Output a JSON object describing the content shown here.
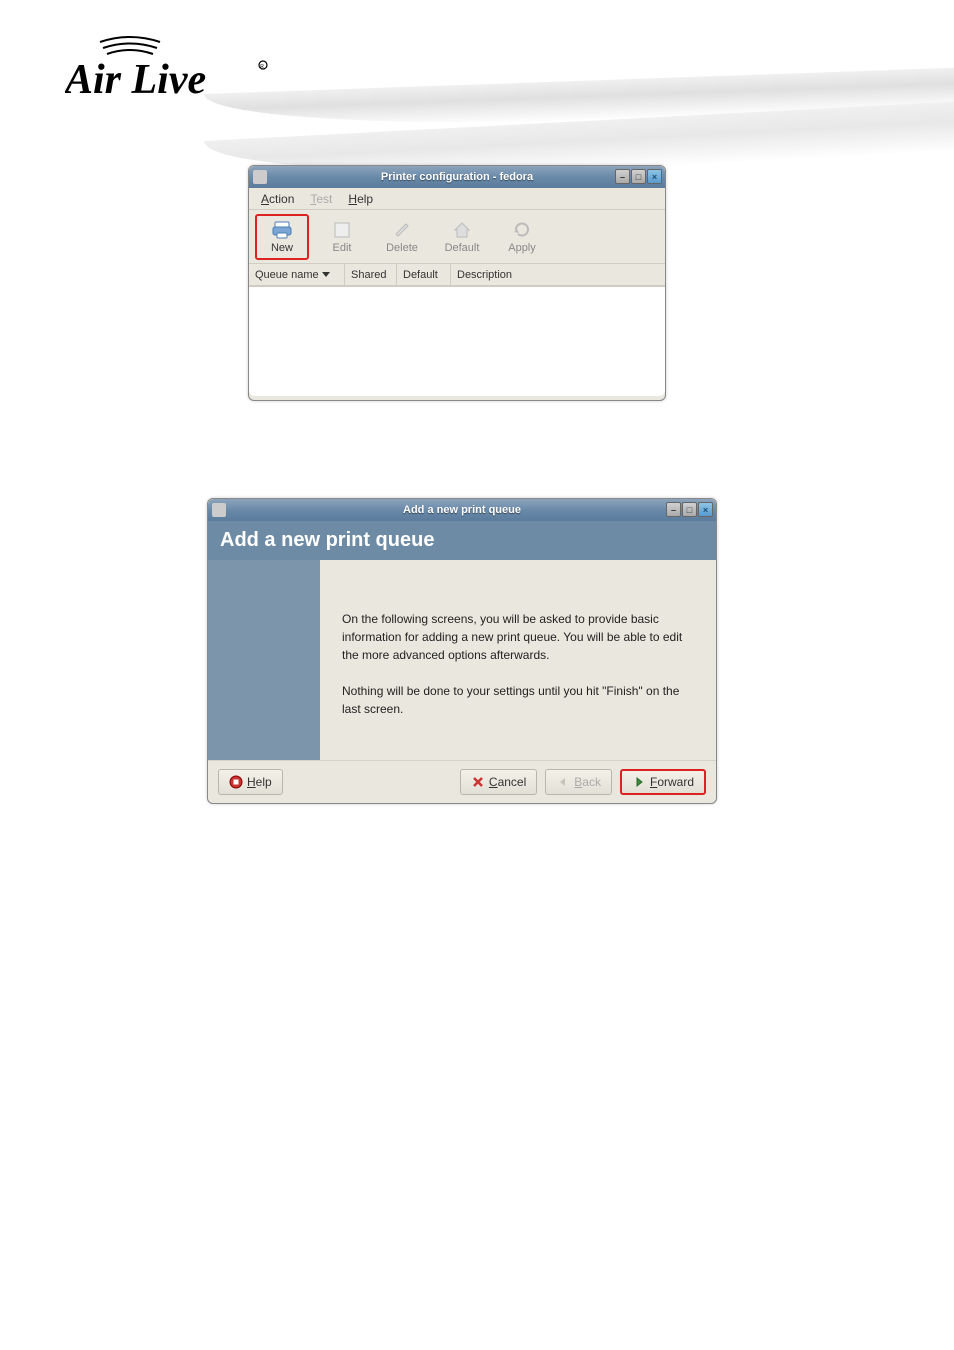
{
  "logo_text": "Air Live",
  "window1": {
    "title": "Printer configuration - fedora",
    "menu": {
      "action": "Action",
      "test": "Test",
      "help": "Help"
    },
    "toolbar": {
      "new": "New",
      "edit": "Edit",
      "delete": "Delete",
      "default": "Default",
      "apply": "Apply"
    },
    "columns": {
      "queue_name": "Queue name",
      "shared": "Shared",
      "default": "Default",
      "description": "Description"
    }
  },
  "window2": {
    "title": "Add a new print queue",
    "heading": "Add a new print queue",
    "para1": "On the following screens, you will be asked to provide basic information for adding a new print queue.  You will be able to edit the more advanced options afterwards.",
    "para2": "Nothing will be done to your settings until you hit \"Finish\" on the last screen.",
    "buttons": {
      "help": "Help",
      "cancel": "Cancel",
      "back": "Back",
      "forward": "Forward"
    }
  }
}
